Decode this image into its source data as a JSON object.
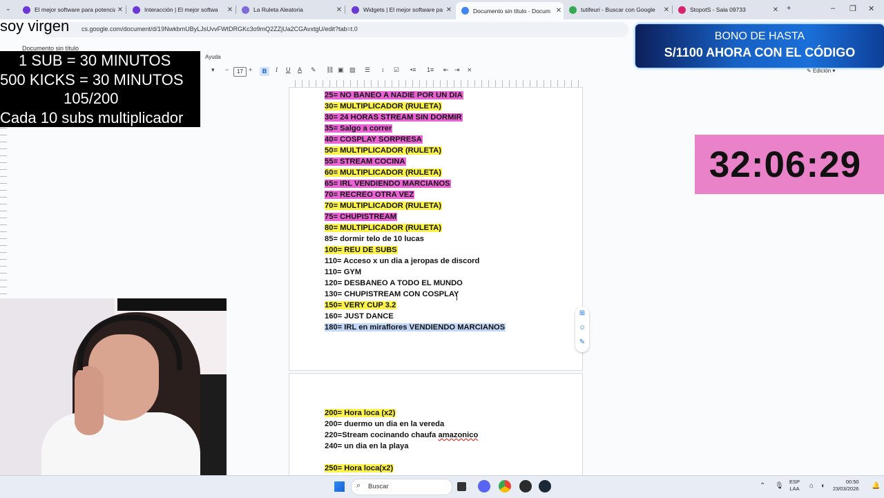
{
  "tabs": [
    {
      "title": "El mejor software para potencia",
      "favicon_color": "#6b38d6"
    },
    {
      "title": "Interacción | El mejor softwa",
      "favicon_color": "#6b38d6"
    },
    {
      "title": "La Ruleta Aleatoria",
      "favicon_color": "#7f6ad9"
    },
    {
      "title": "Widgets | El mejor software pa",
      "favicon_color": "#6b38d6"
    },
    {
      "title": "Documento sin título - Docum",
      "favicon_color": "#4285f4",
      "active": true
    },
    {
      "title": "tutifeuri - Buscar con Google",
      "favicon_color": "#34a853"
    },
    {
      "title": "StopotS - Sala 09733",
      "favicon_color": "#d6246e"
    }
  ],
  "address": {
    "url": "cs.google.com/document/d/19NwkbmUByLJsUvvFWtDRGKc3o9mQ2ZZjUa2CGAvxtgU/edit?tab=t.0"
  },
  "docs": {
    "title": "Documento sin título",
    "menu_help": "Ayuda",
    "font_size": "17",
    "mode": "Edición"
  },
  "overlay": {
    "streamer_name": "soy virgen",
    "rules": [
      "1 SUB     = 30 MINUTOS",
      "500 KICKS = 30 MINUTOS",
      "105/200",
      "Cada 10 subs multiplicador"
    ],
    "promo_line1": "BONO DE HASTA",
    "promo_line2": "S/1100 AHORA CON EL CÓDIGO",
    "timer": "32:06:29"
  },
  "doc_lines_page1": [
    {
      "text": "25= NO BANEO A NADIE POR UN DIA",
      "hl": "pink"
    },
    {
      "text": "30= MULTIPLICADOR (RULETA)",
      "hl": "yellow"
    },
    {
      "text": "30= 24 HORAS STREAM SIN DORMIR",
      "hl": "pink"
    },
    {
      "text": "35= Salgo a correr",
      "hl": "pink"
    },
    {
      "text": "40= COSPLAY SORPRESA",
      "hl": "pink"
    },
    {
      "text": "50=  MULTIPLICADOR (RULETA)",
      "hl": "yellow"
    },
    {
      "text": "55= STREAM COCINA",
      "hl": "pink"
    },
    {
      "text": "60=  MULTIPLICADOR (RULETA)",
      "hl": "yellow"
    },
    {
      "text": "65= IRL VENDIENDO MARCIANOS  ",
      "hl": "pink"
    },
    {
      "text": "70= RECREO OTRA VEZ",
      "hl": "pink"
    },
    {
      "text": "70=  MULTIPLICADOR (RULETA)",
      "hl": "yellow"
    },
    {
      "text": "75= CHUPISTREAM",
      "hl": "pink"
    },
    {
      "text": "80=  MULTIPLICADOR (RULETA)",
      "hl": "yellow"
    },
    {
      "text": "85= dormir telo de 10 lucas",
      "hl": "none"
    },
    {
      "text": "100= REU DE SUBS",
      "hl": "yellow"
    },
    {
      "text": "110= Acceso x un dia a jeropas de discord",
      "hl": "none"
    },
    {
      "text": "110= GYM",
      "hl": "none"
    },
    {
      "text": "120= DESBANEO A TODO EL MUNDO",
      "hl": "none"
    },
    {
      "text": "130= CHUPISTREAM CON COSPLAY",
      "hl": "none"
    },
    {
      "text": "150= VERY CUP 3.2",
      "hl": "yellow"
    },
    {
      "text": "160= JUST DANCE",
      "hl": "none"
    },
    {
      "text": "180= IRL en miraflores VENDIENDO MARCIANOS  ",
      "hl": "sel"
    }
  ],
  "doc_lines_page2": [
    {
      "text": "200= Hora loca (x2)",
      "hl": "yellow"
    },
    {
      "text": "200= duermo un dia en la vereda",
      "hl": "none"
    },
    {
      "text": "220=Stream cocinando chaufa amazonico",
      "hl": "none"
    },
    {
      "text": "240= un dia en la playa",
      "hl": "none"
    },
    {
      "text": "",
      "hl": "none"
    },
    {
      "text": "250= Hora loca(x2)",
      "hl": "yellow"
    }
  ],
  "taskbar": {
    "search_label": "Buscar",
    "lang_top": "ESP",
    "lang_bottom": "LAA",
    "time": "00:50",
    "date": "23/03/2026"
  }
}
